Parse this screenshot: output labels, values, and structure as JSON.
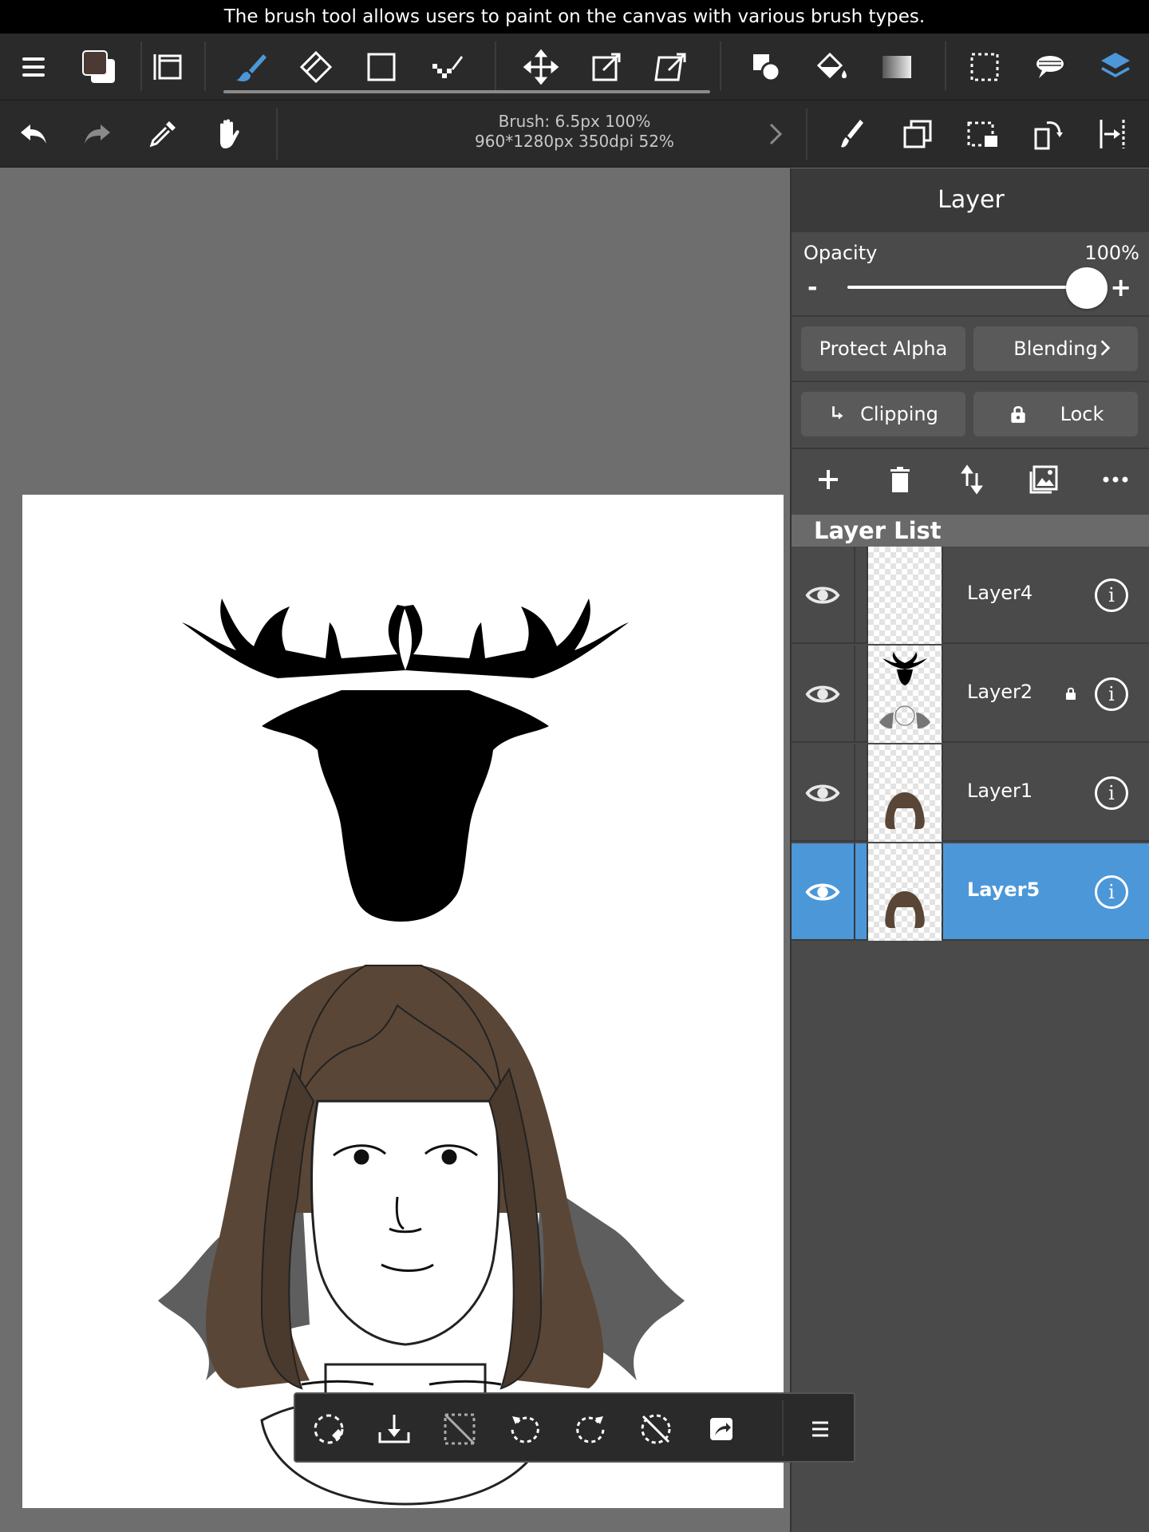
{
  "caption": "The brush tool allows users to paint on the canvas with various brush types.",
  "toolbar_top": {
    "icons": [
      "menu-icon",
      "color-swatch",
      "canvas-frame-icon",
      "brush-icon",
      "eraser-icon",
      "rectangle-select-icon",
      "dot-tool-icon",
      "move-icon",
      "transform-icon",
      "free-transform-icon",
      "shape-fill-icon",
      "bucket-icon",
      "gradient-icon",
      "selection-icon",
      "lasso-icon",
      "layers-icon"
    ],
    "foreground_color": "#4a3a33",
    "background_color": "#ffffff"
  },
  "toolbar_second": {
    "brush_info": "Brush: 6.5px 100%",
    "canvas_info": "960*1280px 350dpi 52%"
  },
  "layer_panel": {
    "title": "Layer",
    "opacity_label": "Opacity",
    "opacity_value": "100%",
    "opacity_fraction": 1.0,
    "minus": "-",
    "plus": "+",
    "protect_alpha": "Protect Alpha",
    "blending": "Blending",
    "clipping": "Clipping",
    "lock": "Lock",
    "list_title": "Layer List",
    "layers": [
      {
        "name": "Layer4",
        "visible": true,
        "locked": false,
        "selected": false
      },
      {
        "name": "Layer2",
        "visible": true,
        "locked": true,
        "selected": false
      },
      {
        "name": "Layer1",
        "visible": true,
        "locked": false,
        "selected": false
      },
      {
        "name": "Layer5",
        "visible": true,
        "locked": false,
        "selected": true
      }
    ]
  },
  "accent_color": "#4c97d8",
  "floating_toolbar": {
    "icons": [
      "reset-transform-icon",
      "import-icon",
      "deselect-icon",
      "rotate-left-icon",
      "rotate-right-icon",
      "no-rotate-icon",
      "share-icon",
      "menu-icon"
    ]
  }
}
